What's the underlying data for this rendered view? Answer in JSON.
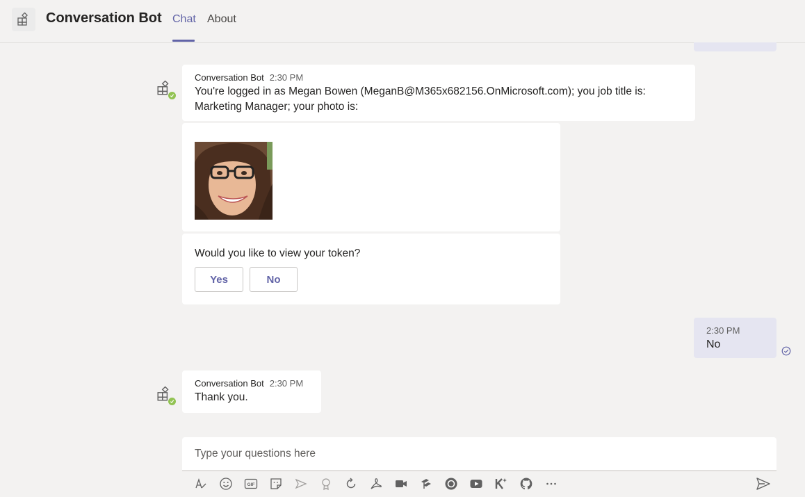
{
  "header": {
    "app_title": "Conversation Bot",
    "tabs": [
      {
        "label": "Chat",
        "active": true
      },
      {
        "label": "About",
        "active": false
      }
    ]
  },
  "messages": [
    {
      "sender": "Conversation Bot",
      "time": "2:30 PM",
      "text": "You're logged in as Megan Bowen (MeganB@M365x682156.OnMicrosoft.com); you job title is: Marketing Manager; your photo is:"
    },
    {
      "card": {
        "question": "Would you like to view your token?",
        "buttons": [
          "Yes",
          "No"
        ]
      }
    },
    {
      "me": true,
      "time": "2:30 PM",
      "text": "No"
    },
    {
      "sender": "Conversation Bot",
      "time": "2:30 PM",
      "text": "Thank you."
    }
  ],
  "compose": {
    "placeholder": "Type your questions here"
  },
  "toolbar": {
    "icons": [
      "format-icon",
      "emoji-icon",
      "gif-icon",
      "sticker-icon",
      "meet-now-icon",
      "praise-icon",
      "loop-icon",
      "pdf-icon",
      "video-icon",
      "stream-icon",
      "circle-app-icon",
      "youtube-icon",
      "klaxoon-icon",
      "github-icon",
      "more-icon"
    ],
    "send_icon": "send-icon"
  },
  "colors": {
    "accent": "#6264a7",
    "background": "#f3f2f1",
    "self_bubble": "#e5e5f1",
    "presence": "#92c353"
  }
}
